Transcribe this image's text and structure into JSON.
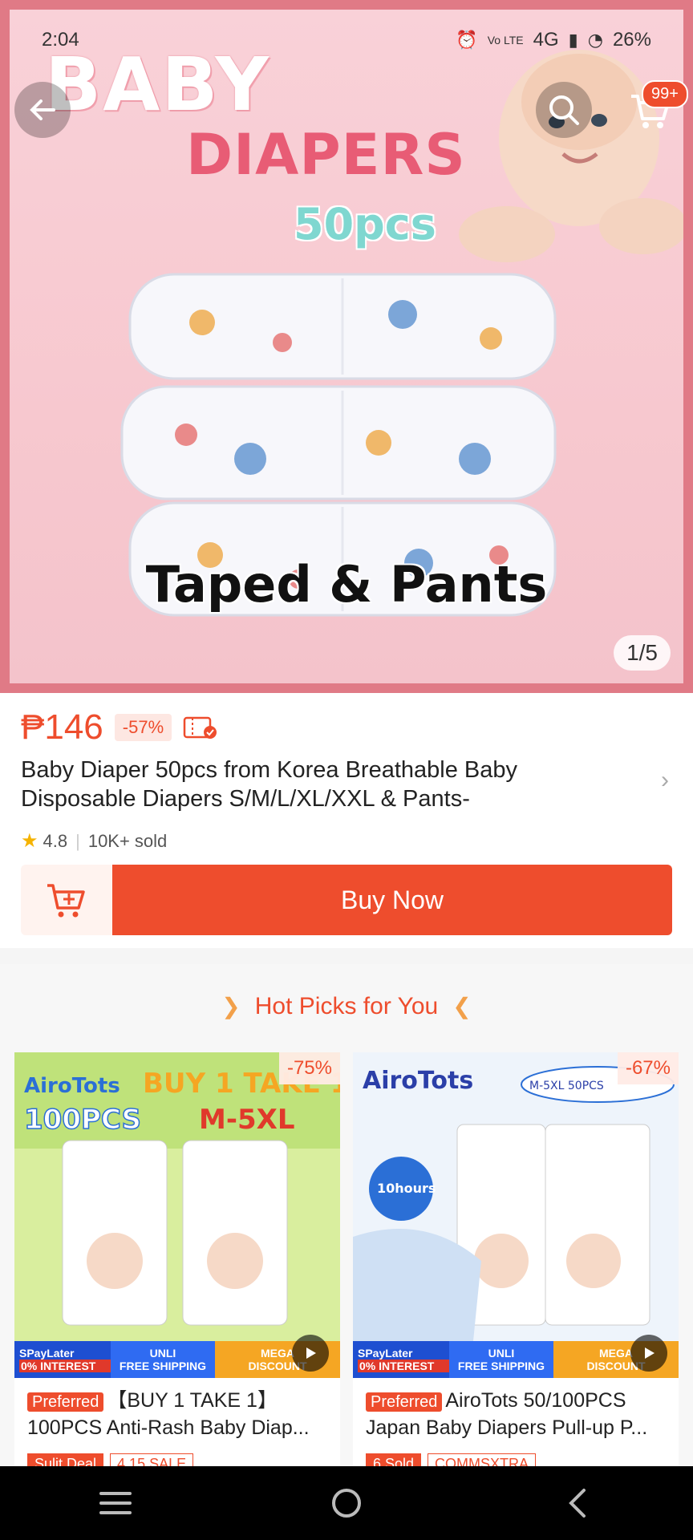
{
  "status_bar": {
    "time": "2:04",
    "network": "4G",
    "battery": "26%"
  },
  "hero": {
    "line1": "BABY",
    "line2": "DIAPERS",
    "line3": "50pcs",
    "line4": "Taped & Pants",
    "cart_badge": "99+",
    "page_indicator": "1/5"
  },
  "product": {
    "price": "₱146",
    "discount": "-57%",
    "title": "Baby Diaper 50pcs from Korea Breathable Baby Disposable Diapers S/M/L/XL/XXL & Pants-",
    "rating": "4.8",
    "sold": "10K+ sold",
    "buy_now_label": "Buy Now"
  },
  "hot_picks": {
    "title": "Hot Picks for You",
    "cards": [
      {
        "discount": "-75%",
        "badge": "Preferred",
        "title": "【BUY 1 TAKE 1】100PCS Anti-Rash Baby Diap...",
        "tags": [
          "Sulit Deal",
          "4.15 SALE"
        ],
        "promo": {
          "a1": "SPayLater",
          "a2": "0% INTEREST",
          "b1": "UNLI",
          "b2": "FREE SHIPPING",
          "c1": "MEGA",
          "c2": "DISCOUNT"
        }
      },
      {
        "discount": "-67%",
        "badge": "Preferred",
        "title": "AiroTots 50/100PCS Japan Baby Diapers Pull-up P...",
        "tags": [
          "6 Sold",
          "COMMSXTRA"
        ],
        "promo": {
          "a1": "SPayLater",
          "a2": "0% INTEREST",
          "b1": "UNLI",
          "b2": "FREE SHIPPING",
          "c1": "MEGA",
          "c2": "DISCOUNT"
        }
      }
    ]
  },
  "colors": {
    "accent": "#ee4d2d",
    "hero_border": "#e07a86"
  }
}
